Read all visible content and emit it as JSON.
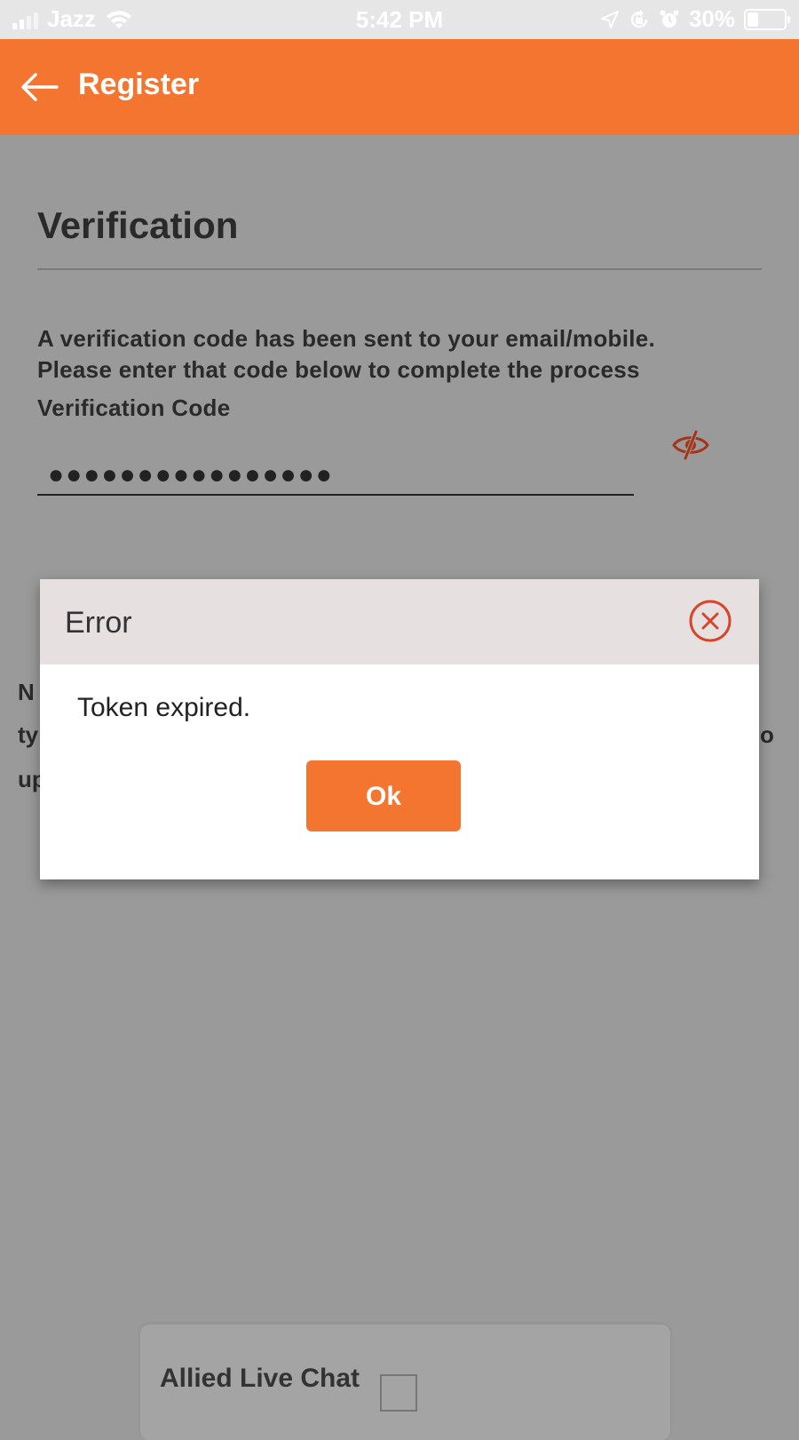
{
  "status_bar": {
    "carrier": "Jazz",
    "time": "5:42 PM",
    "battery_percent": "30%",
    "battery_level": 0.3,
    "icons": [
      "signal-icon",
      "wifi-icon",
      "location-icon",
      "orientation-lock-icon",
      "alarm-icon",
      "battery-icon"
    ]
  },
  "header": {
    "back_icon": "arrow-left-icon",
    "title": "Register",
    "color": "#f3752f"
  },
  "verification": {
    "title": "Verification",
    "instruction_line1": "A verification code has been sent to your email/mobile.",
    "instruction_line2": "Please enter that code below to complete the process",
    "code_label": "Verification Code",
    "code_value": "●●●●●●●●●●●●●●●●",
    "toggle_icon": "eye-slash-icon",
    "obscured_text": [
      "N",
      "ty",
      "up",
      "o"
    ]
  },
  "dialog": {
    "title": "Error",
    "message": "Token expired.",
    "ok_label": "Ok",
    "close_icon": "close-circle-icon",
    "accent": "#d9442a"
  },
  "chat_widget": {
    "title": "Allied Live Chat"
  }
}
